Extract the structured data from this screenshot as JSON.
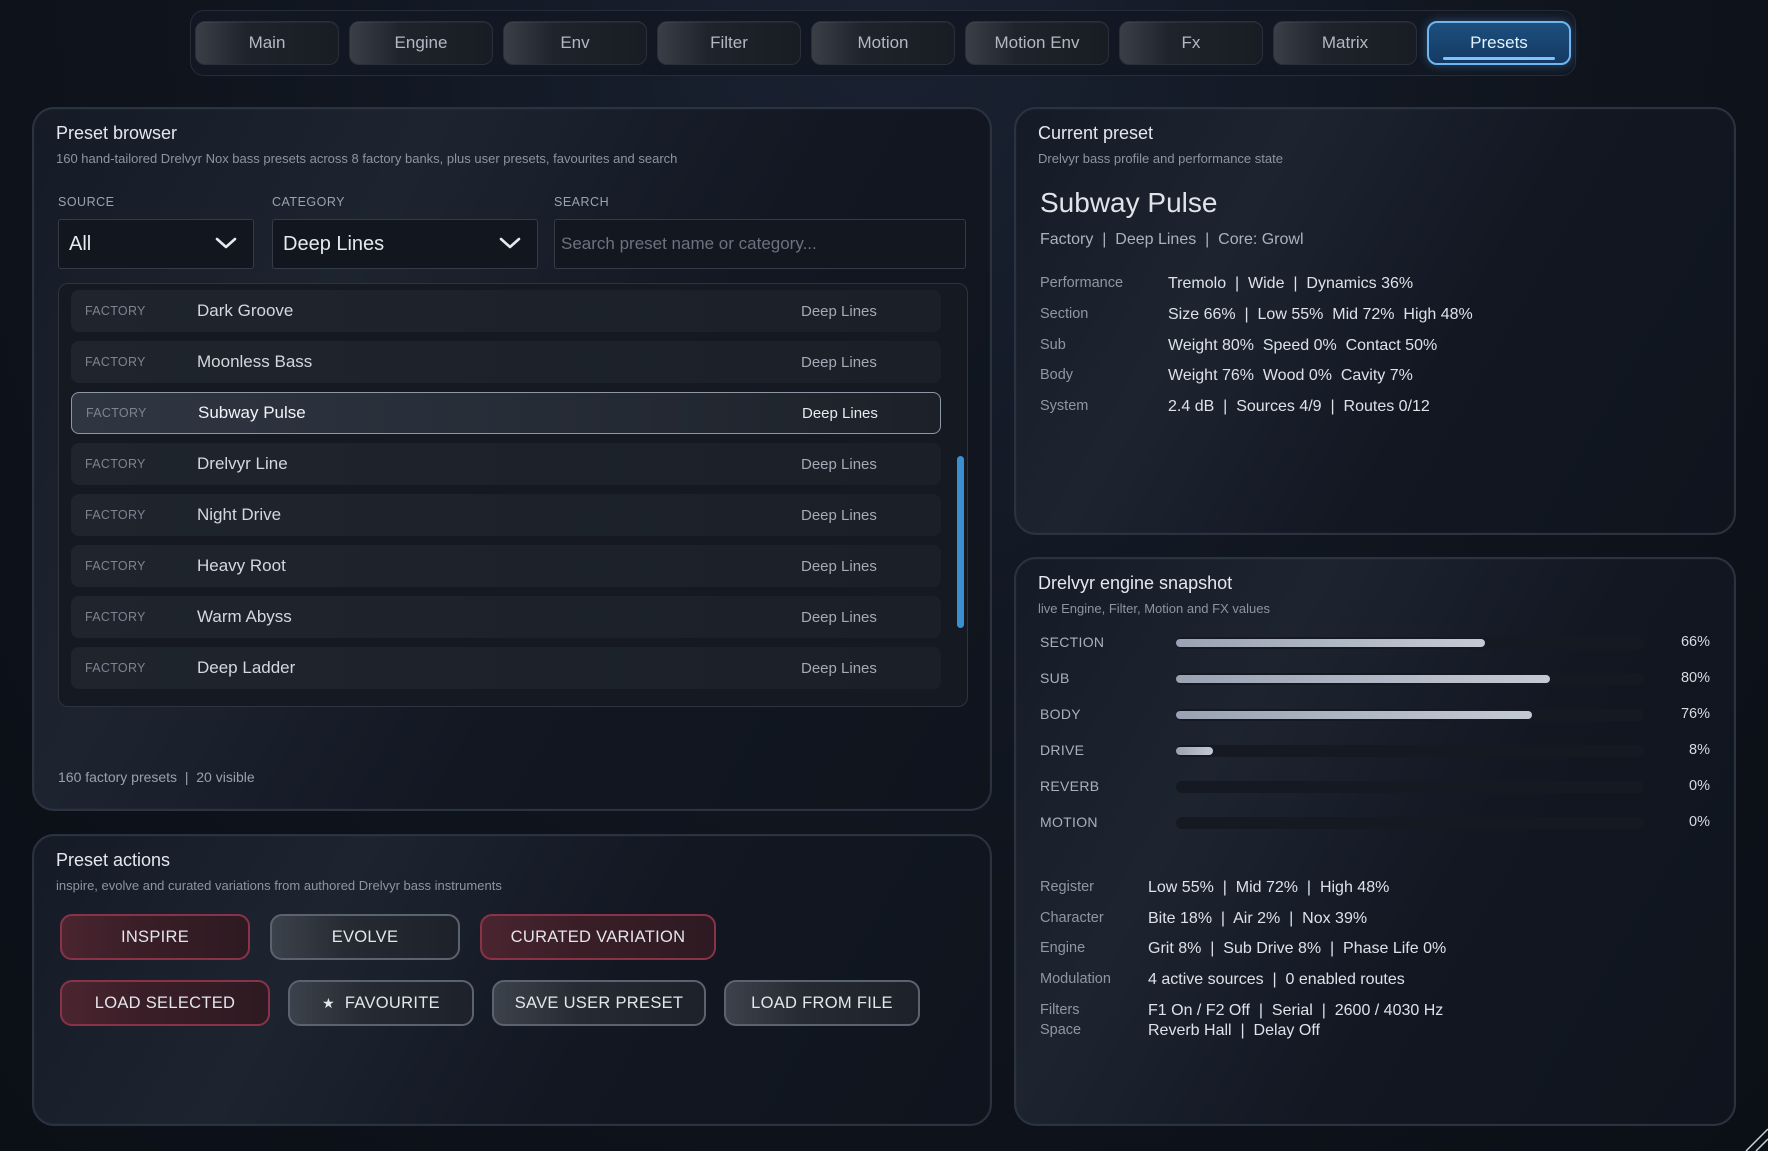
{
  "tabs": [
    "Main",
    "Engine",
    "Env",
    "Filter",
    "Motion",
    "Motion Env",
    "Fx",
    "Matrix",
    "Presets"
  ],
  "active_tab": "Presets",
  "colors": {
    "accent": "#6fb6f0",
    "danger_border": "#8a3348",
    "scroll_thumb": "#3a8fd1"
  },
  "browser": {
    "title": "Preset browser",
    "subtitle": "160 hand-tailored Drelvyr Nox bass presets across 8 factory banks, plus user presets, favourites and search",
    "source_label": "SOURCE",
    "source_value": "All",
    "category_label": "CATEGORY",
    "category_value": "Deep Lines",
    "search_label": "SEARCH",
    "search_placeholder": "Search preset name or category...",
    "search_value": "",
    "rows": [
      {
        "source": "FACTORY",
        "name": "Dark Groove",
        "category": "Deep Lines"
      },
      {
        "source": "FACTORY",
        "name": "Moonless Bass",
        "category": "Deep Lines"
      },
      {
        "source": "FACTORY",
        "name": "Subway Pulse",
        "category": "Deep Lines"
      },
      {
        "source": "FACTORY",
        "name": "Drelvyr Line",
        "category": "Deep Lines"
      },
      {
        "source": "FACTORY",
        "name": "Night Drive",
        "category": "Deep Lines"
      },
      {
        "source": "FACTORY",
        "name": "Heavy Root",
        "category": "Deep Lines"
      },
      {
        "source": "FACTORY",
        "name": "Warm Abyss",
        "category": "Deep Lines"
      },
      {
        "source": "FACTORY",
        "name": "Deep Ladder",
        "category": "Deep Lines"
      }
    ],
    "selected_index": 2,
    "footer": "160 factory presets  |  20 visible"
  },
  "actions": {
    "title": "Preset actions",
    "subtitle": "inspire, evolve and curated variations from authored Drelvyr bass instruments",
    "inspire": "INSPIRE",
    "evolve": "EVOLVE",
    "curated": "CURATED VARIATION",
    "load_selected": "LOAD SELECTED",
    "favourite": "FAVOURITE",
    "favourite_icon": "★",
    "save_user": "SAVE USER PRESET",
    "load_file": "LOAD FROM FILE"
  },
  "current": {
    "title": "Current preset",
    "subtitle": "Drelvyr bass profile and performance state",
    "name": "Subway Pulse",
    "meta": "Factory  |  Deep Lines  |  Core: Growl",
    "rows": [
      {
        "label": "Performance",
        "value": "Tremolo  |  Wide  |  Dynamics 36%"
      },
      {
        "label": "Section",
        "value": "Size 66%  |  Low 55%  Mid 72%  High 48%"
      },
      {
        "label": "Sub",
        "value": "Weight 80%  Speed 0%  Contact 50%"
      },
      {
        "label": "Body",
        "value": "Weight 76%  Wood 0%  Cavity 7%"
      },
      {
        "label": "System",
        "value": "2.4 dB  |  Sources 4/9  |  Routes 0/12"
      }
    ]
  },
  "snapshot": {
    "title": "Drelvyr engine snapshot",
    "subtitle": "live Engine, Filter, Motion and FX values",
    "bars": [
      {
        "label": "SECTION",
        "value": 66,
        "text": "66%"
      },
      {
        "label": "SUB",
        "value": 80,
        "text": "80%"
      },
      {
        "label": "BODY",
        "value": 76,
        "text": "76%"
      },
      {
        "label": "DRIVE",
        "value": 8,
        "text": "8%"
      },
      {
        "label": "REVERB",
        "value": 0,
        "text": "0%"
      },
      {
        "label": "MOTION",
        "value": 0,
        "text": "0%"
      }
    ],
    "rows": [
      {
        "label": "Register",
        "value": "Low 55%  |  Mid 72%  |  High 48%"
      },
      {
        "label": "Character",
        "value": "Bite 18%  |  Air 2%  |  Nox 39%"
      },
      {
        "label": "Engine",
        "value": "Grit 8%  |  Sub Drive 8%  |  Phase Life 0%"
      },
      {
        "label": "Modulation",
        "value": "4 active sources  |  0 enabled routes"
      }
    ],
    "filters_label": "Filters",
    "filters_value": "F1 On / F2 Off  |  Serial  |  2600 / 4030 Hz",
    "space_label": "Space",
    "space_value": "Reverb Hall  |  Delay Off"
  }
}
